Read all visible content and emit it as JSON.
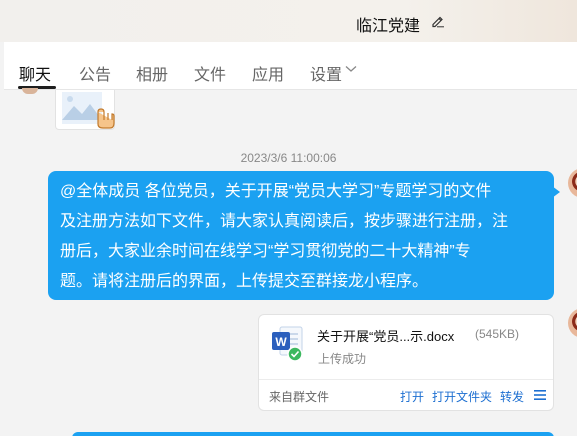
{
  "header": {
    "title": "临江党建",
    "edit_icon": "pencil-icon"
  },
  "tabs": [
    {
      "label": "聊天",
      "active": true
    },
    {
      "label": "公告",
      "active": false
    },
    {
      "label": "相册",
      "active": false
    },
    {
      "label": "文件",
      "active": false
    },
    {
      "label": "应用",
      "active": false
    },
    {
      "label": "设置",
      "active": false,
      "icon": "chevron-down-icon"
    }
  ],
  "messages": {
    "image_thumb_icon": "image-placeholder-icon",
    "timestamp": "2023/3/6 11:00:06",
    "text_lines": [
      "@全体成员 各位党员，关于开展“党员大学习”专题学习的文件",
      "及注册方法如下文件，请大家认真阅读后，按步骤进行注册，注",
      "册后，大家业余时间在线学习“学习贯彻党的二十大精神”专",
      "题。请将注册后的界面，上传提交至群接龙小程序。"
    ],
    "bubble_color": "#1ba1f1"
  },
  "file_card": {
    "icon": "word-doc-icon",
    "file_name": "关于开展“党员...示.docx",
    "file_size": "(545KB)",
    "status": "上传成功",
    "status_icon": "check-circle-icon",
    "source": "来自群文件",
    "actions": {
      "open": "打开",
      "open_folder": "打开文件夹",
      "forward": "转发"
    },
    "menu_icon": "menu-icon"
  }
}
